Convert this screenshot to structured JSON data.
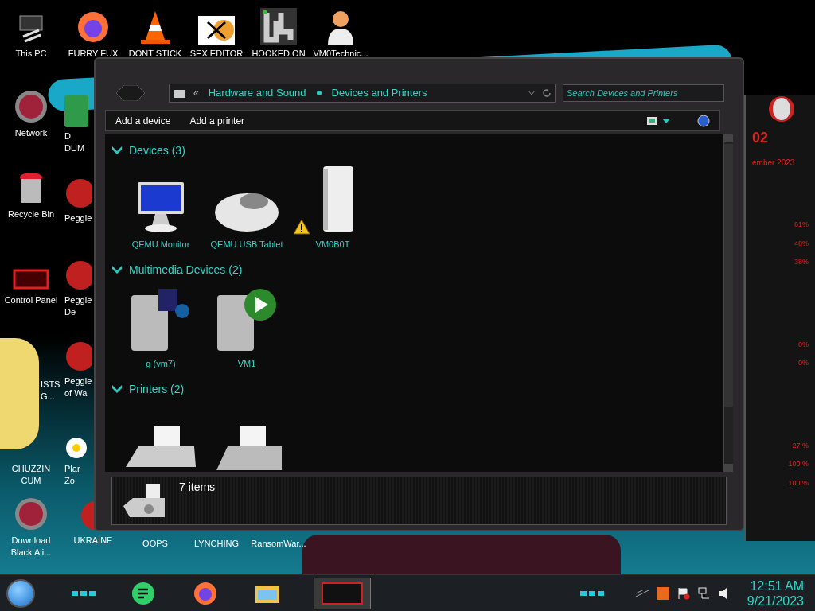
{
  "desktop": {
    "top_row": [
      {
        "label": [
          "This PC"
        ],
        "kind": "pc"
      },
      {
        "label": [
          "FURRY FUX"
        ],
        "kind": "firefox"
      },
      {
        "label": [
          "DONT STICK"
        ],
        "kind": "cone"
      },
      {
        "label": [
          "SEX EDITOR"
        ],
        "kind": "hxd"
      },
      {
        "label": [
          "HOOKED ON"
        ],
        "kind": "maze"
      },
      {
        "label": [
          "VM0Technic..."
        ],
        "kind": "doctor"
      }
    ],
    "left_column": [
      {
        "label": [
          "Network"
        ],
        "kind": "orb"
      },
      {
        "label": [
          "Recycle Bin"
        ],
        "kind": "bin"
      },
      {
        "label": [
          "Control Panel"
        ],
        "kind": "panel"
      },
      {
        "label": [
          "ISTS",
          "G..."
        ],
        "kind": "none"
      },
      {
        "label": [
          "CHUZZIN",
          "CUM"
        ],
        "kind": "none"
      },
      {
        "label": [
          "Download",
          "Black Ali..."
        ],
        "kind": "orb"
      }
    ],
    "second_column": [
      {
        "label": [
          "D",
          "DUM"
        ],
        "kind": "notes"
      },
      {
        "label": [
          "Peggle"
        ],
        "kind": "peggle"
      },
      {
        "label": [
          "Peggle",
          "De"
        ],
        "kind": "peggle"
      },
      {
        "label": [
          "Peggle",
          "of Wa"
        ],
        "kind": "peggle"
      },
      {
        "label": [
          "Plar",
          "Zo"
        ],
        "kind": "flower"
      },
      {
        "label": [
          "UKRAINE"
        ],
        "kind": "peggle"
      }
    ],
    "bottom_row": [
      {
        "label": [
          "OOPS"
        ]
      },
      {
        "label": [
          "LYNCHING"
        ]
      },
      {
        "label": [
          "RansomWar..."
        ]
      }
    ]
  },
  "window": {
    "overflow": "«",
    "breadcrumb": [
      "Hardware and Sound",
      "Devices and Printers"
    ],
    "search": {
      "placeholder": "Search Devices and Printers"
    },
    "commands": [
      "Add a device",
      "Add a printer"
    ],
    "groups": [
      {
        "title": "Devices (3)",
        "expanded": true,
        "items": [
          {
            "name": "QEMU Monitor",
            "kind": "monitor",
            "warning": false
          },
          {
            "name": "QEMU USB Tablet",
            "kind": "mouse",
            "warning": false
          },
          {
            "name": "VM0B0T",
            "kind": "drive",
            "warning": true
          }
        ]
      },
      {
        "title": "Multimedia Devices (2)",
        "expanded": true,
        "items": [
          {
            "name": "g (vm7)",
            "kind": "media-server",
            "warning": false
          },
          {
            "name": "VM1",
            "kind": "media-player",
            "warning": false
          }
        ]
      },
      {
        "title": "Printers (2)",
        "expanded": true,
        "items": [
          {
            "kind": "fax",
            "warning": false
          },
          {
            "kind": "printer",
            "warning": false
          }
        ]
      }
    ],
    "status": "7 items"
  },
  "gadget": {
    "time": "02",
    "date": "ember 2023",
    "readings": [
      "61%",
      "48%",
      "38%",
      "0%",
      "0%",
      "27 %",
      "100 %",
      "100 %"
    ]
  },
  "taskbar": {
    "apps": [
      {
        "kind": "notes",
        "selected": false
      },
      {
        "kind": "firefox",
        "selected": false
      },
      {
        "kind": "explorer",
        "selected": false
      },
      {
        "kind": "thumbnail",
        "selected": true
      }
    ],
    "time": "12:51 AM",
    "date": "9/21/2023"
  }
}
